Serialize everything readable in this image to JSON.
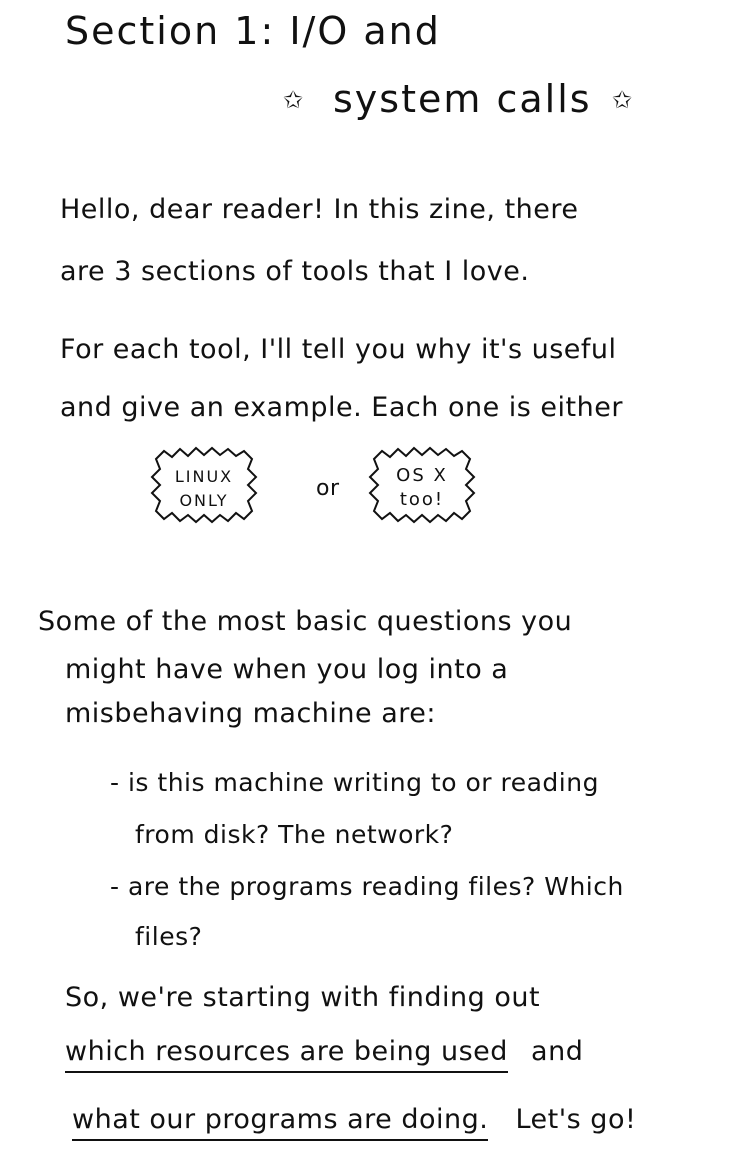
{
  "title": {
    "line1": "Section 1: I/O and",
    "line2": "system calls",
    "star_icon": "star-icon"
  },
  "intro": {
    "lines": [
      "Hello, dear reader! In this zine, there",
      "are 3 sections of tools that I love.",
      "For each tool, I'll tell you why it's useful",
      "and give an example. Each one is either"
    ]
  },
  "badges": {
    "linux": {
      "line1": "LINUX",
      "line2": "ONLY"
    },
    "or": "or",
    "osx": {
      "line1": "OS X",
      "line2": "too!"
    }
  },
  "questions": {
    "lines": [
      "Some of the most basic questions you",
      "might have when you log into a",
      "misbehaving machine are:"
    ],
    "bullets": [
      {
        "line1": "- is this machine writing to or reading",
        "line2": "from disk?  The network?"
      },
      {
        "line1": "- are the programs reading files? Which",
        "line2": "files?"
      }
    ]
  },
  "closing": {
    "line1": "So, we're starting with finding out",
    "line2_underlined": "which resources are being used",
    "line2_rest": "and",
    "line3_underlined": "what our programs are doing.",
    "line3_rest": "Let's go!"
  }
}
